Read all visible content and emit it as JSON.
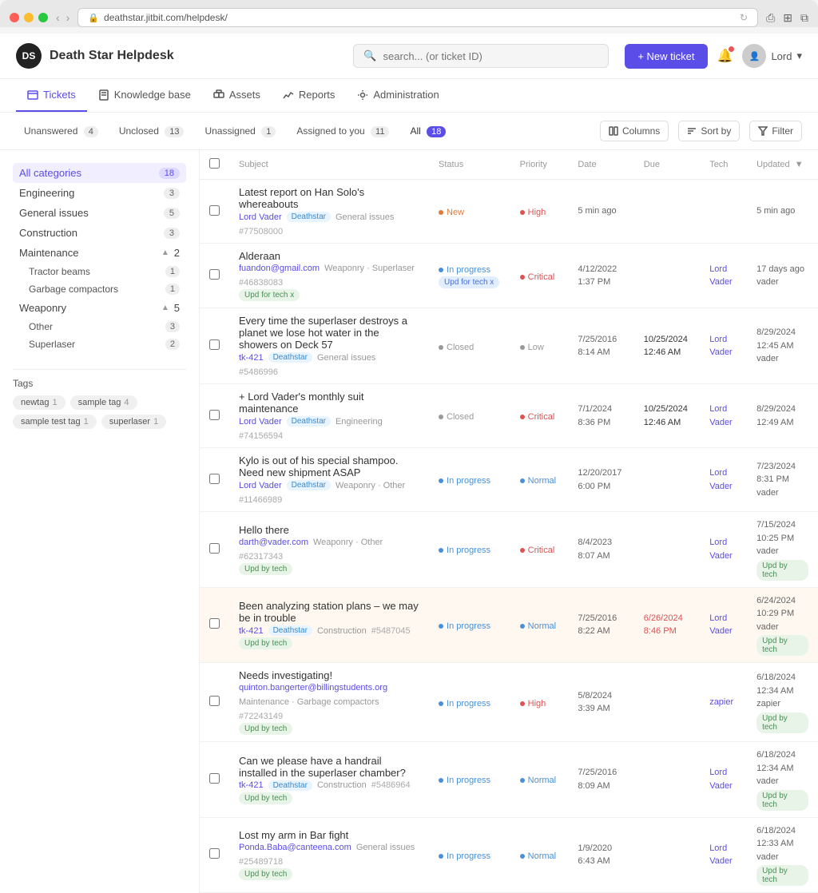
{
  "browser": {
    "url": "deathstar.jitbit.com/helpdesk/",
    "refresh_icon": "↻"
  },
  "app": {
    "title": "Death Star Helpdesk",
    "logo_text": "DS"
  },
  "header": {
    "search_placeholder": "search... (or ticket ID)",
    "new_ticket_label": "+ New ticket",
    "user_label": "Lord",
    "user_chevron": "▾"
  },
  "nav": {
    "items": [
      {
        "label": "Tickets",
        "icon": "tickets",
        "active": true
      },
      {
        "label": "Knowledge base",
        "icon": "book",
        "active": false
      },
      {
        "label": "Assets",
        "icon": "assets",
        "active": false
      },
      {
        "label": "Reports",
        "icon": "reports",
        "active": false
      },
      {
        "label": "Administration",
        "icon": "gear",
        "active": false
      }
    ]
  },
  "filter_bar": {
    "chips": [
      {
        "label": "Unanswered",
        "count": "4",
        "active": false
      },
      {
        "label": "Unclosed",
        "count": "13",
        "active": false
      },
      {
        "label": "Unassigned",
        "count": "1",
        "active": false
      },
      {
        "label": "Assigned to you",
        "count": "11",
        "active": false
      },
      {
        "label": "All",
        "count": "18",
        "active": true
      }
    ],
    "columns_label": "Columns",
    "sort_label": "Sort by",
    "filter_label": "Filter"
  },
  "sidebar": {
    "categories_label": "All categories",
    "categories_count": "18",
    "categories": [
      {
        "label": "Engineering",
        "count": "3"
      },
      {
        "label": "General issues",
        "count": "5"
      },
      {
        "label": "Construction",
        "count": "3"
      },
      {
        "label": "Maintenance",
        "count": "2",
        "has_children": true,
        "expanded": true,
        "children": [
          {
            "label": "Tractor beams",
            "count": "1"
          },
          {
            "label": "Garbage compactors",
            "count": "1"
          }
        ]
      },
      {
        "label": "Weaponry",
        "count": "5",
        "has_children": true,
        "expanded": true,
        "children": [
          {
            "label": "Other",
            "count": "3"
          },
          {
            "label": "Superlaser",
            "count": "2"
          }
        ]
      }
    ],
    "tags_title": "Tags",
    "tags": [
      {
        "label": "newtag",
        "count": "1"
      },
      {
        "label": "sample tag",
        "count": "4"
      },
      {
        "label": "sample test tag",
        "count": "1"
      },
      {
        "label": "superlaser",
        "count": "1"
      }
    ]
  },
  "table": {
    "headers": [
      {
        "label": "Subject",
        "key": "subject"
      },
      {
        "label": "Status",
        "key": "status"
      },
      {
        "label": "Priority",
        "key": "priority"
      },
      {
        "label": "Date",
        "key": "date"
      },
      {
        "label": "Due",
        "key": "due"
      },
      {
        "label": "Tech",
        "key": "tech"
      },
      {
        "label": "Updated",
        "key": "updated",
        "sorted": true
      }
    ],
    "rows": [
      {
        "id": 1,
        "subject": "Latest report on Han Solo's whereabouts",
        "from": "Lord Vader",
        "tags": [
          "Deathstar"
        ],
        "category": "General issues",
        "ticket_id": "#77508000",
        "status": "New",
        "status_class": "status-new",
        "priority": "High",
        "priority_class": "priority-high",
        "date": "5 min ago",
        "date2": "",
        "due": "",
        "tech": "",
        "tech2": "",
        "updated": "5 min ago",
        "updated2": "",
        "upd_tag": "",
        "highlighted": false
      },
      {
        "id": 2,
        "subject": "Alderaan",
        "from": "fuandon@gmail.com",
        "tags": [],
        "category": "Weaponry · Superlaser",
        "ticket_id": "#46838083",
        "status": "In progress",
        "status_class": "status-inprogress",
        "extra_tag": "Upd for tech x",
        "priority": "Critical",
        "priority_class": "priority-critical",
        "date": "4/12/2022",
        "date2": "1:37 PM",
        "due": "",
        "tech": "Lord",
        "tech2": "Vader",
        "updated": "17 days ago",
        "updated2": "vader",
        "upd_tag": "",
        "highlighted": false
      },
      {
        "id": 3,
        "subject": "Every time the superlaser destroys a planet we lose hot water in the showers on Deck 57",
        "from": "tk-421",
        "tags": [
          "Deathstar"
        ],
        "category": "General issues",
        "ticket_id": "#5486996",
        "status": "Closed",
        "status_class": "status-closed",
        "priority": "Low",
        "priority_class": "priority-low",
        "date": "7/25/2016",
        "date2": "8:14 AM",
        "due": "10/25/2024",
        "due2": "12:46 AM",
        "due_overdue": false,
        "tech": "Lord",
        "tech2": "Vader",
        "updated": "8/29/2024",
        "updated2": "12:45 AM",
        "updated3": "vader",
        "upd_tag": "",
        "highlighted": false
      },
      {
        "id": 4,
        "subject": "+ Lord Vader's monthly suit maintenance",
        "from": "Lord Vader",
        "tags": [
          "Deathstar"
        ],
        "category": "Engineering",
        "ticket_id": "#74156594",
        "status": "Closed",
        "status_class": "status-closed",
        "priority": "Critical",
        "priority_class": "priority-critical",
        "date": "7/1/2024",
        "date2": "8:36 PM",
        "due": "10/25/2024",
        "due2": "12:46 AM",
        "due_overdue": false,
        "tech": "Lord",
        "tech2": "Vader",
        "updated": "8/29/2024",
        "updated2": "12:49 AM",
        "upd_tag": "",
        "highlighted": false
      },
      {
        "id": 5,
        "subject": "Kylo is out of his special shampoo. Need new shipment ASAP",
        "from": "Lord Vader",
        "tags": [
          "Deathstar"
        ],
        "category": "Weaponry · Other",
        "ticket_id": "#11466989",
        "status": "In progress",
        "status_class": "status-inprogress",
        "priority": "Normal",
        "priority_class": "priority-normal",
        "date": "12/20/2017",
        "date2": "6:00 PM",
        "due": "",
        "tech": "Lord",
        "tech2": "Vader",
        "updated": "7/23/2024",
        "updated2": "8:31 PM",
        "updated3": "vader",
        "upd_tag": "",
        "highlighted": false
      },
      {
        "id": 6,
        "subject": "Hello there",
        "from": "darth@vader.com",
        "tags": [],
        "category": "Weaponry · Other",
        "ticket_id": "#62317343",
        "status": "In progress",
        "status_class": "status-inprogress",
        "extra_tag": "Upd by tech",
        "priority": "Critical",
        "priority_class": "priority-critical",
        "date": "8/4/2023",
        "date2": "8:07 AM",
        "due": "",
        "tech": "Lord",
        "tech2": "Vader",
        "updated": "7/15/2024",
        "updated2": "10:25 PM",
        "updated3": "vader",
        "upd_tag": "Upd by tech",
        "highlighted": false
      },
      {
        "id": 7,
        "subject": "Been analyzing station plans – we may be in trouble",
        "from": "tk-421",
        "tags": [
          "Deathstar"
        ],
        "category": "Construction",
        "ticket_id": "#5487045",
        "status": "In progress",
        "status_class": "status-inprogress",
        "extra_tag": "Upd by tech",
        "priority": "Normal",
        "priority_class": "priority-normal",
        "date": "7/25/2016",
        "date2": "8:22 AM",
        "due": "6/26/2024",
        "due2": "8:46 PM",
        "due_overdue": true,
        "tech": "Lord",
        "tech2": "Vader",
        "updated": "6/24/2024",
        "updated2": "10:29 PM",
        "updated3": "vader",
        "upd_tag": "Upd by tech",
        "highlighted": true
      },
      {
        "id": 8,
        "subject": "Needs investigating!",
        "from": "quinton.bangerter@billingstudents.org",
        "tags": [],
        "category": "Maintenance · Garbage compactors",
        "ticket_id": "#72243149",
        "status": "In progress",
        "status_class": "status-inprogress",
        "extra_tag": "Upd by tech",
        "priority": "High",
        "priority_class": "priority-high",
        "date": "5/8/2024",
        "date2": "3:39 AM",
        "due": "",
        "tech": "zapier",
        "tech2": "",
        "updated": "6/18/2024",
        "updated2": "12:34 AM",
        "updated3": "zapier",
        "upd_tag": "Upd by tech",
        "highlighted": false
      },
      {
        "id": 9,
        "subject": "Can we please have a handrail installed in the superlaser chamber?",
        "from": "tk-421",
        "tags": [
          "Deathstar"
        ],
        "category": "Construction",
        "ticket_id": "#5486964",
        "status": "In progress",
        "status_class": "status-inprogress",
        "extra_tag": "Upd by tech",
        "priority": "Normal",
        "priority_class": "priority-normal",
        "date": "7/25/2016",
        "date2": "8:09 AM",
        "due": "",
        "tech": "Lord",
        "tech2": "Vader",
        "updated": "6/18/2024",
        "updated2": "12:34 AM",
        "updated3": "vader",
        "upd_tag": "Upd by tech",
        "highlighted": false
      },
      {
        "id": 10,
        "subject": "Lost my arm in Bar fight",
        "from": "Ponda.Baba@canteena.com",
        "tags": [],
        "category": "General issues",
        "ticket_id": "#25489718",
        "status": "In progress",
        "status_class": "status-inprogress",
        "extra_tag": "Upd by tech",
        "priority": "Normal",
        "priority_class": "priority-normal",
        "date": "1/9/2020",
        "date2": "6:43 AM",
        "due": "",
        "tech": "Lord",
        "tech2": "Vader",
        "updated": "6/18/2024",
        "updated2": "12:33 AM",
        "updated3": "vader",
        "upd_tag": "Upd by tech",
        "highlighted": false
      }
    ]
  }
}
